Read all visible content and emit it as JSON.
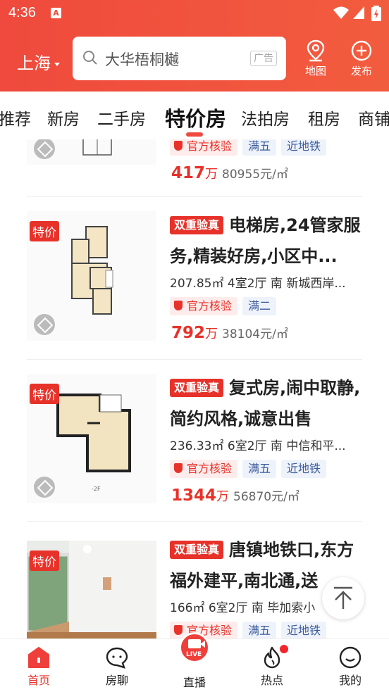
{
  "status_bar": {
    "time": "4:36"
  },
  "header": {
    "city": "上海",
    "search_text": "大华梧桐樾",
    "ad_label": "广告",
    "map_label": "地图",
    "publish_label": "发布"
  },
  "tabs": [
    {
      "label": "推荐"
    },
    {
      "label": "新房"
    },
    {
      "label": "二手房"
    },
    {
      "label": "特价房"
    },
    {
      "label": "法拍房"
    },
    {
      "label": "租房"
    },
    {
      "label": "商铺"
    }
  ],
  "listings": [
    {
      "verify_label": "官方核验",
      "chips": [
        "满五",
        "近地铁"
      ],
      "price": "417",
      "price_unit": "万",
      "unit_price": "80955元/㎡"
    },
    {
      "badge": "特价",
      "tag": "双重验真",
      "title": "电梯房,24管家服务,精装好房,小区中...",
      "meta": "207.85㎡ 4室2厅 南 新城西岸...",
      "verify_label": "官方核验",
      "chips": [
        "满二"
      ],
      "price": "792",
      "price_unit": "万",
      "unit_price": "38104元/㎡"
    },
    {
      "badge": "特价",
      "tag": "双重验真",
      "title": "复式房,闹中取静,简约风格,诚意出售",
      "meta": "236.33㎡ 6室2厅 南 中信和平...",
      "verify_label": "官方核验",
      "chips": [
        "满五",
        "近地铁"
      ],
      "price": "1344",
      "price_unit": "万",
      "unit_price": "56870元/㎡",
      "floor_label": "-2F"
    },
    {
      "badge": "特价",
      "tag": "双重验真",
      "title": "唐镇地铁口,东方福外建平,南北通,送",
      "meta": "166㎡ 6室2厅 南 毕加索小",
      "verify_label": "官方核验",
      "chips": [
        "满五",
        "近地铁"
      ]
    }
  ],
  "bottom_nav": [
    {
      "label": "首页"
    },
    {
      "label": "房聊"
    },
    {
      "label": "直播"
    },
    {
      "label": "热点"
    },
    {
      "label": "我的"
    }
  ],
  "live_badge": "LIVE",
  "colors": {
    "brand_red": "#ef4a3d",
    "price_red": "#e7322a",
    "chip_blue_bg": "#eef2fb"
  }
}
